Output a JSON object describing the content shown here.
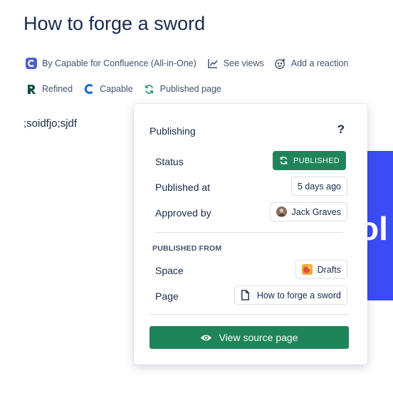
{
  "page": {
    "title": "How to forge a sword",
    "body_text": ";soidfjo;sjdf"
  },
  "byline": {
    "app_label": "By Capable for Confluence (All-in-One)",
    "views_label": "See views",
    "reaction_label": "Add a reaction"
  },
  "status_row": {
    "refined_label": "Refined",
    "capable_label": "Capable",
    "published_label": "Published page"
  },
  "background_block": {
    "visible_text": "ol",
    "color": "#3a4cf5"
  },
  "popover": {
    "title": "Publishing",
    "help_label": "?",
    "status_label": "Status",
    "status_value": "PUBLISHED",
    "published_at_label": "Published at",
    "published_at_value": "5 days ago",
    "approved_by_label": "Approved by",
    "approved_by_value": "Jack Graves",
    "published_from_heading": "PUBLISHED FROM",
    "space_label": "Space",
    "space_value": "Drafts",
    "page_label": "Page",
    "page_value": "How to forge a sword",
    "view_source_label": "View source page"
  },
  "colors": {
    "accent_green": "#1f845a",
    "text_primary": "#172b4d",
    "capable_blue": "#1868db",
    "refined_dark": "#0f4c45"
  },
  "icons": {
    "app": "capable-logo-icon",
    "views": "chart-line-icon",
    "reaction": "smiley-add-icon",
    "refined": "refined-logo-icon",
    "capable": "capable-c-icon",
    "published": "sync-icon",
    "status": "sync-icon",
    "avatar": "avatar",
    "space": "space-icon",
    "page": "document-icon",
    "view": "eye-icon"
  }
}
